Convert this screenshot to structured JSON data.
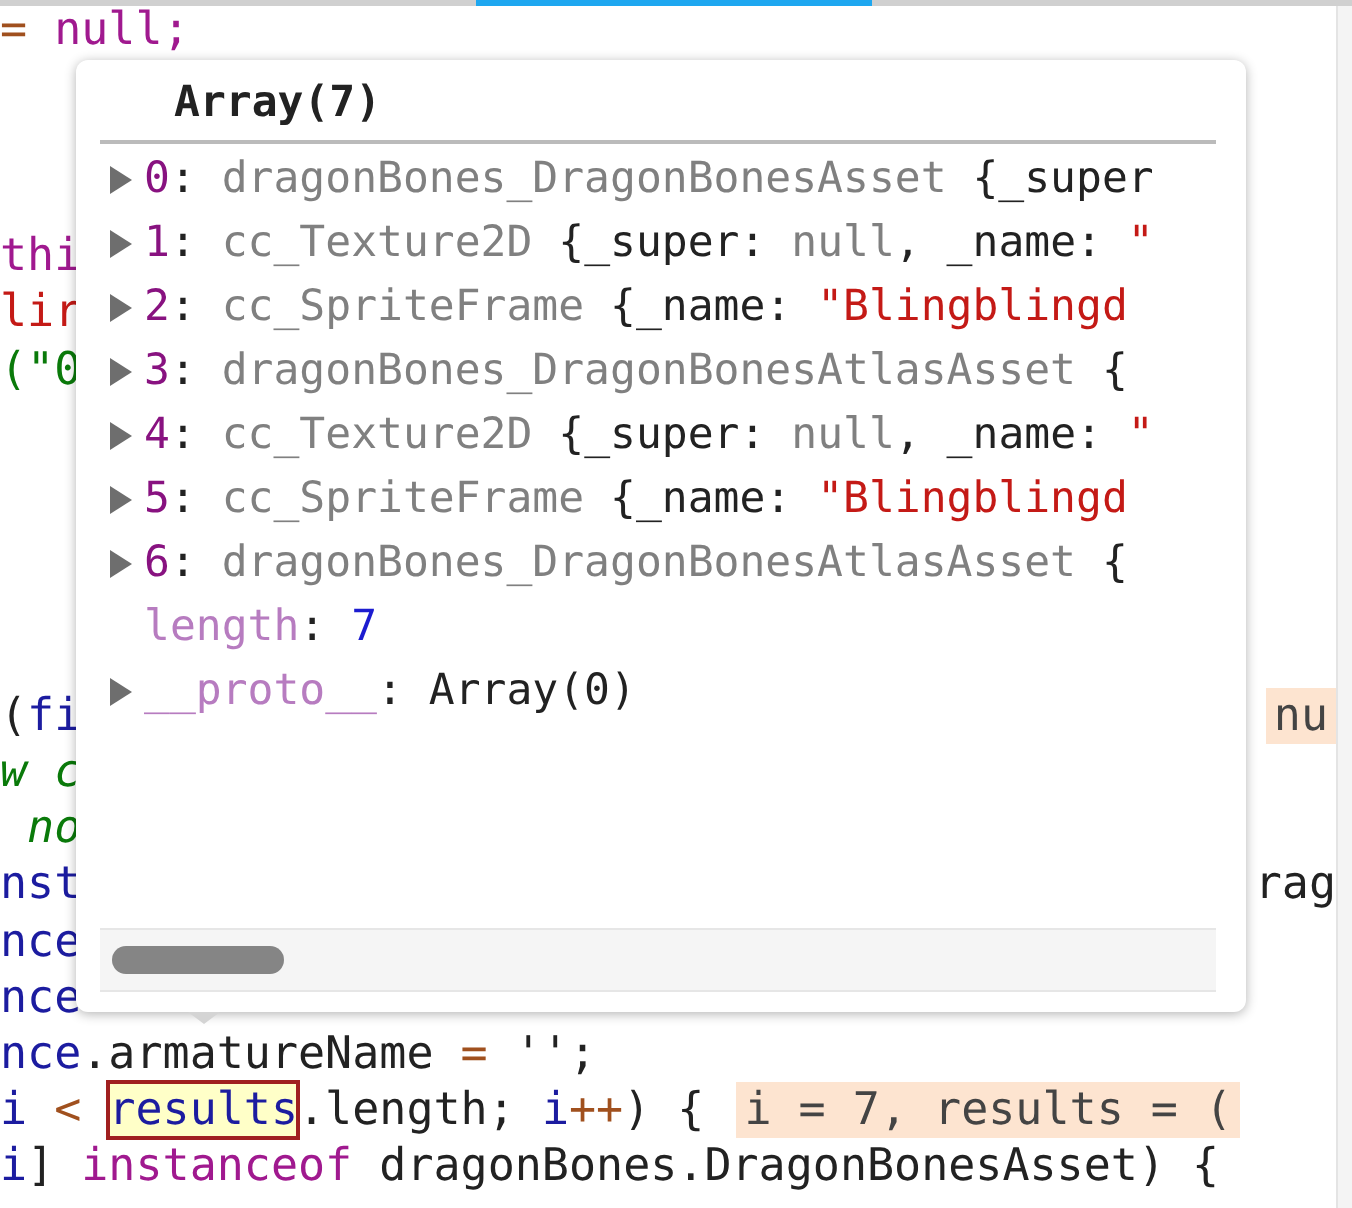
{
  "editor": {
    "code_blocks": [
      {
        "lines": [
          {
            "left": [
              {
                "text": "= ",
                "kind": "op"
              },
              {
                "text": "null;",
                "kind": "kw"
              }
            ]
          }
        ]
      },
      {
        "lines": [
          {
            "left": [
              {
                "text": "thi",
                "kind": "kw"
              }
            ]
          },
          {
            "left": [
              {
                "text": "lir",
                "kind": "str"
              }
            ]
          },
          {
            "left": [
              {
                "text": "(\"0",
                "kind": "green"
              }
            ]
          }
        ]
      },
      {
        "lines": [
          {
            "left": [
              {
                "text": "(",
                "kind": "plain"
              },
              {
                "text": "fi",
                "kind": "var"
              }
            ],
            "right": [
              {
                "text": "nu",
                "kind": "inline"
              }
            ]
          },
          {
            "left": [
              {
                "text": "w c",
                "kind": "comment"
              }
            ]
          },
          {
            "left": [
              {
                "text": " no",
                "kind": "comment"
              }
            ]
          },
          {
            "left": [
              {
                "text": "nst",
                "kind": "var"
              }
            ],
            "right": [
              {
                "text": "rag",
                "kind": "plain"
              }
            ]
          },
          {
            "left": [
              {
                "text": "nce",
                "kind": "var"
              }
            ]
          },
          {
            "left": [
              {
                "text": "nce",
                "kind": "var"
              }
            ]
          },
          {
            "left": [
              {
                "text": "nce",
                "kind": "var"
              },
              {
                "text": ".armatureName ",
                "kind": "plain"
              },
              {
                "text": "=",
                "kind": "op"
              },
              {
                "text": " '';",
                "kind": "plain"
              }
            ]
          },
          {
            "left": [
              {
                "text": "i ",
                "kind": "var"
              },
              {
                "text": "< ",
                "kind": "op"
              },
              {
                "text": "results",
                "kind": "hover"
              },
              {
                "text": ".length; ",
                "kind": "plain"
              },
              {
                "text": "i",
                "kind": "var"
              },
              {
                "text": "++",
                "kind": "op"
              },
              {
                "text": ") {",
                "kind": "plain"
              },
              {
                "text": "i = 7, results = (",
                "kind": "inline"
              }
            ]
          },
          {
            "left": [
              {
                "text": "i",
                "kind": "var"
              },
              {
                "text": "] ",
                "kind": "plain"
              },
              {
                "text": "instanceof",
                "kind": "kw"
              },
              {
                "text": " dragonBones.DragonBonesAsset) {",
                "kind": "plain"
              }
            ]
          }
        ]
      }
    ]
  },
  "popover": {
    "title": "Array(7)",
    "items": [
      {
        "index": "0",
        "expanded": false,
        "parts": [
          {
            "text": ": ",
            "kind": "plain"
          },
          {
            "text": "dragonBones_DragonBonesAsset",
            "kind": "type"
          },
          {
            "text": " {_super",
            "kind": "plain"
          }
        ]
      },
      {
        "index": "1",
        "expanded": false,
        "parts": [
          {
            "text": ": ",
            "kind": "plain"
          },
          {
            "text": "cc_Texture2D",
            "kind": "type"
          },
          {
            "text": " {_super: ",
            "kind": "plain"
          },
          {
            "text": "null",
            "kind": "type"
          },
          {
            "text": ", _name: ",
            "kind": "plain"
          },
          {
            "text": "\"",
            "kind": "str"
          }
        ]
      },
      {
        "index": "2",
        "expanded": false,
        "parts": [
          {
            "text": ": ",
            "kind": "plain"
          },
          {
            "text": "cc_SpriteFrame",
            "kind": "type"
          },
          {
            "text": " {_name: ",
            "kind": "plain"
          },
          {
            "text": "\"Blingblingd",
            "kind": "str"
          }
        ]
      },
      {
        "index": "3",
        "expanded": false,
        "parts": [
          {
            "text": ": ",
            "kind": "plain"
          },
          {
            "text": "dragonBones_DragonBonesAtlasAsset",
            "kind": "type"
          },
          {
            "text": " {",
            "kind": "plain"
          }
        ]
      },
      {
        "index": "4",
        "expanded": false,
        "parts": [
          {
            "text": ": ",
            "kind": "plain"
          },
          {
            "text": "cc_Texture2D",
            "kind": "type"
          },
          {
            "text": " {_super: ",
            "kind": "plain"
          },
          {
            "text": "null",
            "kind": "type"
          },
          {
            "text": ", _name: ",
            "kind": "plain"
          },
          {
            "text": "\"",
            "kind": "str"
          }
        ]
      },
      {
        "index": "5",
        "expanded": false,
        "parts": [
          {
            "text": ": ",
            "kind": "plain"
          },
          {
            "text": "cc_SpriteFrame",
            "kind": "type"
          },
          {
            "text": " {_name: ",
            "kind": "plain"
          },
          {
            "text": "\"Blingblingd",
            "kind": "str"
          }
        ]
      },
      {
        "index": "6",
        "expanded": false,
        "parts": [
          {
            "text": ": ",
            "kind": "plain"
          },
          {
            "text": "dragonBones_DragonBonesAtlasAsset",
            "kind": "type"
          },
          {
            "text": " {",
            "kind": "plain"
          }
        ]
      }
    ],
    "length": {
      "parts": [
        {
          "text": "length",
          "kind": "key"
        },
        {
          "text": ": ",
          "kind": "plain"
        },
        {
          "text": "7",
          "kind": "num"
        }
      ]
    },
    "proto": {
      "expanded": false,
      "parts": [
        {
          "text": "__proto__",
          "kind": "key"
        },
        {
          "text": ": Array(0)",
          "kind": "plain"
        }
      ]
    }
  }
}
